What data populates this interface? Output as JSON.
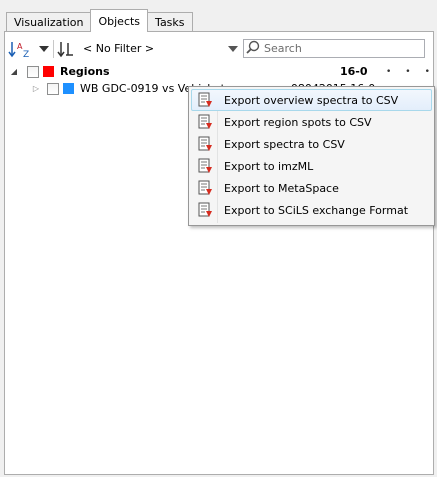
{
  "tabs": [
    {
      "label": "Visualization",
      "active": false
    },
    {
      "label": "Objects",
      "active": true
    },
    {
      "label": "Tasks",
      "active": false
    }
  ],
  "toolbar": {
    "sort_icon": "sort-alpha-icon",
    "filter_icon": "sort-order-icon",
    "filter_value": "< No Filter >",
    "search_placeholder": "Search"
  },
  "tree": {
    "root": {
      "label": "Regions",
      "date": "16-0",
      "swatch_color": "#ff0000"
    },
    "child": {
      "label": "WB GDC-0919 vs Vehicle tumor zoom 08042015  16-0",
      "swatch_color": "#1e90ff"
    }
  },
  "context_menu": {
    "items": [
      {
        "label": "Export overview spectra to CSV",
        "icon": "export-icon",
        "hover": true
      },
      {
        "label": "Export region spots to CSV",
        "icon": "export-icon",
        "hover": false
      },
      {
        "label": "Export spectra to CSV",
        "icon": "export-icon",
        "hover": false
      },
      {
        "label": "Export to imzML",
        "icon": "export-icon",
        "hover": false
      },
      {
        "label": "Export to MetaSpace",
        "icon": "export-icon",
        "hover": false
      },
      {
        "label": "Export to SCiLS exchange Format",
        "icon": "export-icon",
        "hover": false
      }
    ]
  },
  "colors": {
    "accent_red": "#ff0000",
    "accent_blue": "#1e90ff",
    "menu_hover": "#e3eefb"
  }
}
